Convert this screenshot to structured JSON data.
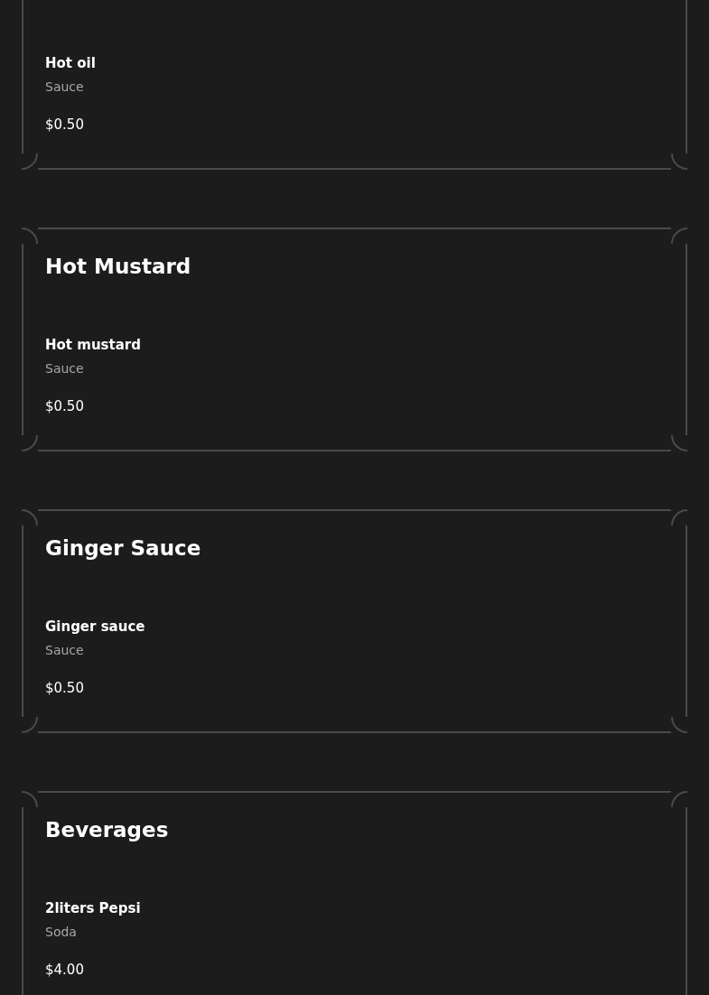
{
  "sections": [
    {
      "items": [
        {
          "name": "Hot oil",
          "category": "Sauce",
          "price": "$0.50"
        }
      ]
    },
    {
      "title": "Hot Mustard",
      "items": [
        {
          "name": "Hot mustard",
          "category": "Sauce",
          "price": "$0.50"
        }
      ]
    },
    {
      "title": "Ginger Sauce",
      "items": [
        {
          "name": "Ginger sauce",
          "category": "Sauce",
          "price": "$0.50"
        }
      ]
    },
    {
      "title": "Beverages",
      "items": [
        {
          "name": "2liters Pepsi",
          "category": "Soda",
          "price": "$4.00"
        }
      ]
    }
  ]
}
